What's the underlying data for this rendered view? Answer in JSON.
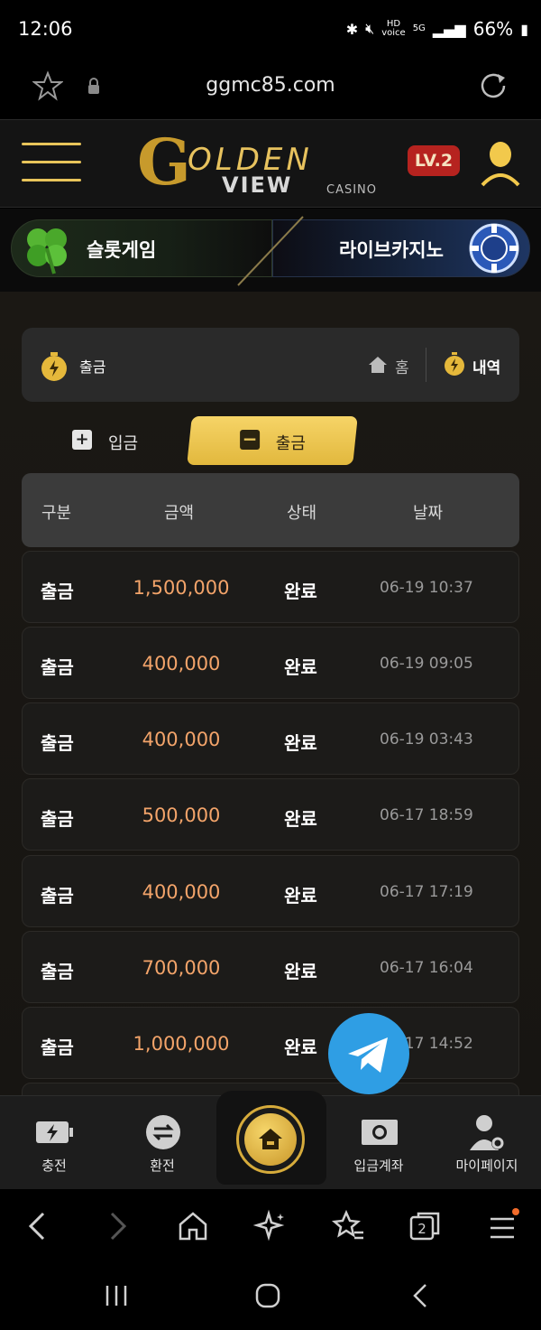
{
  "status_bar": {
    "time": "12:06",
    "battery": "66%",
    "hd_label": "HD",
    "voice_label": "voice",
    "network_label": "5G"
  },
  "browser": {
    "url": "ggmc85.com",
    "tab_count": "2"
  },
  "header": {
    "logo_top": "OLDEN",
    "logo_g": "G",
    "logo_bottom": "VIEW",
    "logo_casino": "CASINO",
    "level": "LV.2"
  },
  "game_tabs": {
    "slot": "슬롯게임",
    "live": "라이브카지노"
  },
  "page_header": {
    "title": "출금",
    "home": "홈",
    "history": "내역"
  },
  "tabs": {
    "deposit": "입금",
    "withdraw": "출금",
    "deposit_icon": "+",
    "withdraw_icon": "−"
  },
  "table": {
    "columns": [
      "구분",
      "금액",
      "상태",
      "날짜"
    ],
    "rows": [
      {
        "type": "출금",
        "amount": "1,500,000",
        "status": "완료",
        "date": "06-19 10:37"
      },
      {
        "type": "출금",
        "amount": "400,000",
        "status": "완료",
        "date": "06-19 09:05"
      },
      {
        "type": "출금",
        "amount": "400,000",
        "status": "완료",
        "date": "06-19 03:43"
      },
      {
        "type": "출금",
        "amount": "500,000",
        "status": "완료",
        "date": "06-17 18:59"
      },
      {
        "type": "출금",
        "amount": "400,000",
        "status": "완료",
        "date": "06-17 17:19"
      },
      {
        "type": "출금",
        "amount": "700,000",
        "status": "완료",
        "date": "06-17 16:04"
      },
      {
        "type": "출금",
        "amount": "1,000,000",
        "status": "완료",
        "date": "06-17 14:52"
      }
    ]
  },
  "bottom_nav": {
    "charge": "충전",
    "exchange": "환전",
    "account": "입금계좌",
    "mypage": "마이페이지"
  },
  "colors": {
    "accent_gold": "#e8c45a",
    "amount_orange": "#f3a46a",
    "level_red": "#b6231f",
    "telegram_blue": "#2f9ee4"
  }
}
